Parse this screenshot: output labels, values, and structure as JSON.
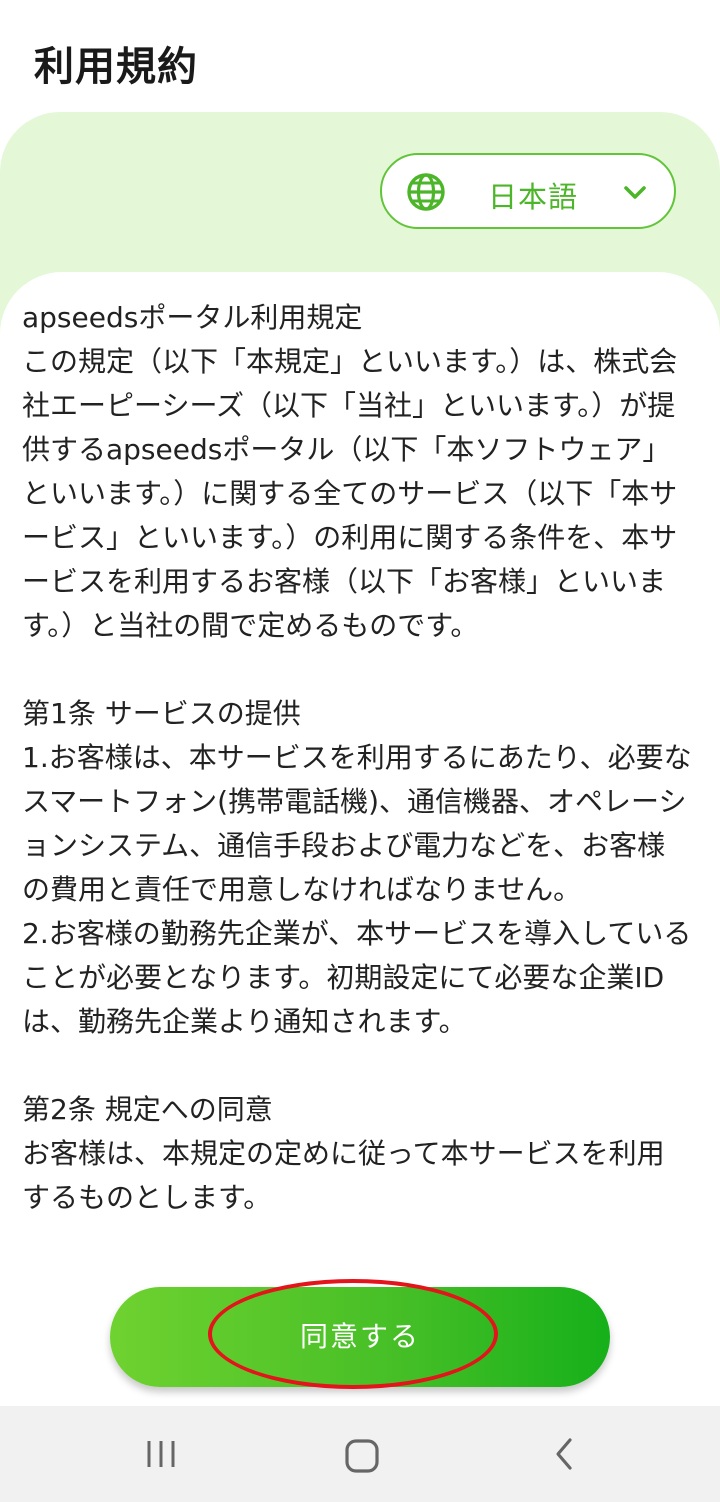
{
  "header": {
    "title": "利用規約"
  },
  "language": {
    "selected": "日本語",
    "icon": "globe-icon",
    "dropdown_icon": "chevron-down-icon"
  },
  "terms": {
    "body": "apseedsポータル利用規定\nこの規定（以下「本規定」といいます。）は、株式会社エーピーシーズ（以下「当社」といいます。）が提供するapseedsポータル（以下「本ソフトウェア」といいます。）に関する全てのサービス（以下「本サービス」といいます。）の利用に関する条件を、本サービスを利用するお客様（以下「お客様」といいます。）と当社の間で定めるものです。\n\n第1条 サービスの提供\n1.お客様は、本サービスを利用するにあたり、必要なスマートフォン(携帯電話機)、通信機器、オペレーションシステム、通信手段および電力などを、お客様の費用と責任で用意しなければなりません。\n2.お客様の勤務先企業が、本サービスを導入していることが必要となります。初期設定にて必要な企業IDは、勤務先企業より通知されます。\n\n第2条 規定への同意\nお客様は、本規定の定めに従って本サービスを利用するものとします。"
  },
  "actions": {
    "agree_label": "同意する"
  },
  "colors": {
    "accent": "#4db52a",
    "band": "#e4f8d8",
    "button_start": "#6fd230",
    "button_end": "#16b01a",
    "highlight": "#e3141b"
  },
  "nav": {
    "recents_icon": "recents-icon",
    "home_icon": "home-icon",
    "back_icon": "back-icon"
  }
}
